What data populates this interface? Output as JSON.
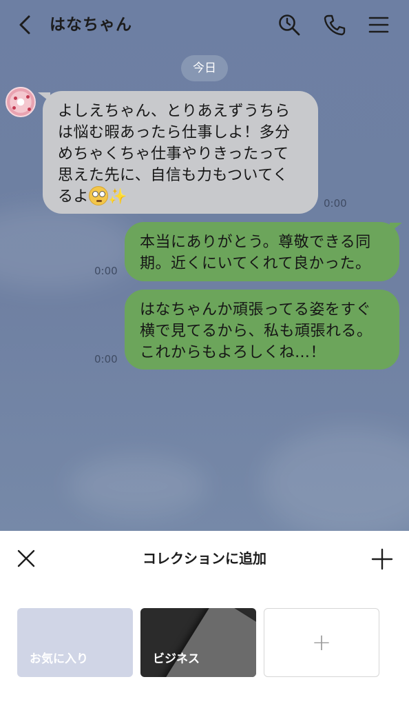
{
  "header": {
    "title": "はなちゃん"
  },
  "chat": {
    "date_label": "今日",
    "messages": [
      {
        "direction": "incoming",
        "text": "よしえちゃん、とりあえずうちらは悩む暇あったら仕事しよ！多分めちゃくちゃ仕事やりきったって思えた先に、自信も力もついてくるよ",
        "emoji": [
          "face-with-rolling-eyes",
          "sparkles"
        ],
        "time": "0:00"
      },
      {
        "direction": "outgoing",
        "text": "本当にありがとう。尊敬できる同期。近くにいてくれて良かった。",
        "time": "0:00"
      },
      {
        "direction": "outgoing",
        "text": "はなちゃんか頑張ってる姿をすぐ横で見てるから、私も頑張れる。これからもよろしくね…！",
        "time": "0:00"
      }
    ]
  },
  "collection_sheet": {
    "title": "コレクションに追加",
    "collections": [
      {
        "label": "お気に入り"
      },
      {
        "label": "ビジネス"
      }
    ],
    "new_collection_symbol": "+"
  },
  "icons": {
    "back": "chevron-left-icon",
    "search": "search-icon",
    "call": "phone-icon",
    "menu": "hamburger-menu-icon",
    "close": "close-icon",
    "add": "plus-icon"
  },
  "colors": {
    "chat_background": "#6f80a2",
    "incoming_bubble": "#c8c9cc",
    "outgoing_bubble": "#6ca55b",
    "date_pill": "#8c9bb6",
    "favorites_card": "#d0d5e6",
    "business_card": "#2b2b2b"
  }
}
